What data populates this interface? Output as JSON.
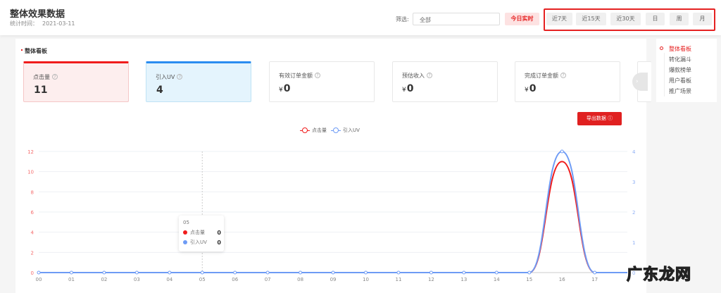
{
  "header": {
    "title": "整体效果数据",
    "time_label": "统计时间：",
    "time_value": "2021-03-11",
    "filter_label": "筛选:",
    "filter_value": "全部",
    "today_label": "今日实时",
    "ranges": [
      "近7天",
      "近15天",
      "近30天",
      "日",
      "周",
      "月"
    ]
  },
  "section_title": "整体看板",
  "cards": [
    {
      "label": "点击量",
      "value": "11",
      "currency": ""
    },
    {
      "label": "引入UV",
      "value": "4",
      "currency": ""
    },
    {
      "label": "有效订单金额",
      "value": "0",
      "currency": "¥"
    },
    {
      "label": "预估收入",
      "value": "0",
      "currency": "¥"
    },
    {
      "label": "完成订单金额",
      "value": "0",
      "currency": "¥"
    }
  ],
  "export_label": "导出数据",
  "right_nav": [
    "整体看板",
    "转化漏斗",
    "爆款榜单",
    "用户看板",
    "推广场景"
  ],
  "tooltip": {
    "title": "05",
    "rows": [
      {
        "name": "点击量",
        "value": "0",
        "color": "#f01c1c"
      },
      {
        "name": "引入UV",
        "value": "0",
        "color": "#6e9bf5"
      }
    ]
  },
  "watermark": "广东龙网",
  "chart_data": {
    "type": "line",
    "categories": [
      "00",
      "01",
      "02",
      "03",
      "04",
      "05",
      "06",
      "07",
      "08",
      "09",
      "10",
      "11",
      "12",
      "13",
      "14",
      "15",
      "16",
      "17"
    ],
    "series": [
      {
        "name": "点击量",
        "axis": "left",
        "color": "#f01c1c",
        "values": [
          0,
          0,
          0,
          0,
          0,
          0,
          0,
          0,
          0,
          0,
          0,
          0,
          0,
          0,
          0,
          0,
          11,
          0
        ]
      },
      {
        "name": "引入UV",
        "axis": "right",
        "color": "#6e9bf5",
        "values": [
          0,
          0,
          0,
          0,
          0,
          0,
          0,
          0,
          0,
          0,
          0,
          0,
          0,
          0,
          0,
          0,
          4,
          0
        ]
      }
    ],
    "y_left": {
      "range": [
        0,
        12
      ],
      "ticks": [
        "0",
        "2",
        "4",
        "6",
        "8",
        "10",
        "12"
      ]
    },
    "y_right": {
      "range": [
        0,
        4
      ],
      "ticks": [
        "0",
        "1",
        "2",
        "3",
        "4"
      ]
    },
    "legend": "top-center",
    "grid": true
  }
}
